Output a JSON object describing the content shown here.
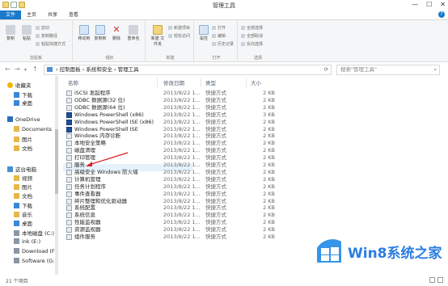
{
  "window": {
    "title": "管理工具",
    "minimize": "—",
    "maximize": "☐",
    "close": "✕"
  },
  "ribbon_tabs": [
    "文件",
    "主页",
    "共享",
    "查看"
  ],
  "ribbon": {
    "clipboard": {
      "label": "剪贴板",
      "copy": "复制",
      "paste": "粘贴",
      "cut": "剪切",
      "copy_path": "复制路径",
      "paste_shortcut": "粘贴快捷方式"
    },
    "organize": {
      "label": "组织",
      "move_to": "移动到",
      "copy_to": "复制到",
      "delete": "删除",
      "rename": "重命名"
    },
    "new": {
      "label": "新建",
      "new_folder": "新建\n文件夹",
      "new_item": "新建项目",
      "easy_access": "轻松访问"
    },
    "open": {
      "label": "打开",
      "properties": "属性",
      "open": "打开",
      "edit": "编辑",
      "history": "历史记录"
    },
    "select": {
      "label": "选择",
      "select_all": "全部选择",
      "select_none": "全部取消",
      "invert": "反向选择"
    }
  },
  "address": {
    "path": "› 控制面板 › 系统和安全 › 管理工具",
    "search_placeholder": "搜索\"管理工具\""
  },
  "columns": {
    "name": "名称",
    "date": "修改日期",
    "type": "类型",
    "size": "大小"
  },
  "nav": [
    {
      "label": "收藏夹",
      "icon": "star-icon",
      "indent": 0
    },
    {
      "label": "下载",
      "icon": "download-icon",
      "indent": 1
    },
    {
      "label": "桌面",
      "icon": "desktop-icon",
      "indent": 1
    },
    {
      "label": "OneDrive",
      "icon": "cloud-icon",
      "indent": 0
    },
    {
      "label": "Documents",
      "icon": "folder-icon",
      "indent": 1
    },
    {
      "label": "图片",
      "icon": "folder-icon",
      "indent": 1
    },
    {
      "label": "文档",
      "icon": "folder-icon",
      "indent": 1
    },
    {
      "label": "这台电脑",
      "icon": "computer-icon",
      "indent": 0
    },
    {
      "label": "视频",
      "icon": "video-icon",
      "indent": 1
    },
    {
      "label": "图片",
      "icon": "picture-icon",
      "indent": 1
    },
    {
      "label": "文档",
      "icon": "document-icon",
      "indent": 1
    },
    {
      "label": "下载",
      "icon": "download-icon",
      "indent": 1
    },
    {
      "label": "音乐",
      "icon": "music-icon",
      "indent": 1
    },
    {
      "label": "桌面",
      "icon": "desktop-icon",
      "indent": 1
    },
    {
      "label": "本地磁盘 (C:)",
      "icon": "drive-icon",
      "indent": 1
    },
    {
      "label": "ink (E:)",
      "icon": "drive-icon",
      "indent": 1
    },
    {
      "label": "Download (F",
      "icon": "drive-icon",
      "indent": 1
    },
    {
      "label": "Software (G:",
      "icon": "drive-icon",
      "indent": 1
    }
  ],
  "files": [
    {
      "name": "iSCSI 发起程序",
      "date": "2013/8/22 1...",
      "type": "快捷方式",
      "size": "2 KB",
      "icon": "shortcut-icon"
    },
    {
      "name": "ODBC 数据源(32 位)",
      "date": "2013/8/22 1...",
      "type": "快捷方式",
      "size": "2 KB",
      "icon": "shortcut-icon"
    },
    {
      "name": "ODBC 数据源(64 位)",
      "date": "2013/8/22 1...",
      "type": "快捷方式",
      "size": "2 KB",
      "icon": "shortcut-icon"
    },
    {
      "name": "Windows PowerShell (x86)",
      "date": "2013/8/22 1...",
      "type": "快捷方式",
      "size": "3 KB",
      "icon": "powershell-icon"
    },
    {
      "name": "Windows PowerShell ISE (x86)",
      "date": "2013/8/22 1...",
      "type": "快捷方式",
      "size": "2 KB",
      "icon": "powershell-icon"
    },
    {
      "name": "Windows PowerShell ISE",
      "date": "2013/8/22 1...",
      "type": "快捷方式",
      "size": "2 KB",
      "icon": "powershell-icon"
    },
    {
      "name": "Windows 内存诊断",
      "date": "2013/8/22 1...",
      "type": "快捷方式",
      "size": "2 KB",
      "icon": "shortcut-icon"
    },
    {
      "name": "本地安全策略",
      "date": "2013/8/22 1...",
      "type": "快捷方式",
      "size": "2 KB",
      "icon": "shortcut-icon"
    },
    {
      "name": "磁盘清理",
      "date": "2013/8/22 1...",
      "type": "快捷方式",
      "size": "2 KB",
      "icon": "shortcut-icon"
    },
    {
      "name": "打印管理",
      "date": "2013/8/22 1...",
      "type": "快捷方式",
      "size": "2 KB",
      "icon": "shortcut-icon"
    },
    {
      "name": "服务",
      "date": "2013/8/22 1...",
      "type": "快捷方式",
      "size": "2 KB",
      "icon": "shortcut-icon"
    },
    {
      "name": "高级安全 Windows 防火墙",
      "date": "2013/8/22 1...",
      "type": "快捷方式",
      "size": "2 KB",
      "icon": "shortcut-icon"
    },
    {
      "name": "计算机管理",
      "date": "2013/8/22 1...",
      "type": "快捷方式",
      "size": "2 KB",
      "icon": "shortcut-icon"
    },
    {
      "name": "任务计划程序",
      "date": "2013/8/22 1...",
      "type": "快捷方式",
      "size": "2 KB",
      "icon": "shortcut-icon"
    },
    {
      "name": "事件查看器",
      "date": "2013/8/22 1...",
      "type": "快捷方式",
      "size": "2 KB",
      "icon": "shortcut-icon"
    },
    {
      "name": "碎片整理和优化驱动器",
      "date": "2013/8/22 1...",
      "type": "快捷方式",
      "size": "2 KB",
      "icon": "shortcut-icon"
    },
    {
      "name": "系统配置",
      "date": "2013/8/22 1...",
      "type": "快捷方式",
      "size": "2 KB",
      "icon": "shortcut-icon"
    },
    {
      "name": "系统信息",
      "date": "2013/8/22 1...",
      "type": "快捷方式",
      "size": "2 KB",
      "icon": "shortcut-icon"
    },
    {
      "name": "性能监视器",
      "date": "2013/8/22 1...",
      "type": "快捷方式",
      "size": "2 KB",
      "icon": "shortcut-icon"
    },
    {
      "name": "资源监视器",
      "date": "2013/8/22 1...",
      "type": "快捷方式",
      "size": "2 KB",
      "icon": "shortcut-icon"
    },
    {
      "name": "组件服务",
      "date": "2013/8/22 1...",
      "type": "快捷方式",
      "size": "2 KB",
      "icon": "shortcut-icon"
    }
  ],
  "status": {
    "item_count": "21 个项目"
  },
  "watermark": {
    "text": "Win8系统之家"
  },
  "colors": {
    "accent": "#1979ca",
    "annotation_arrow": "#e02020",
    "watermark_blue": "#2a7de1"
  }
}
